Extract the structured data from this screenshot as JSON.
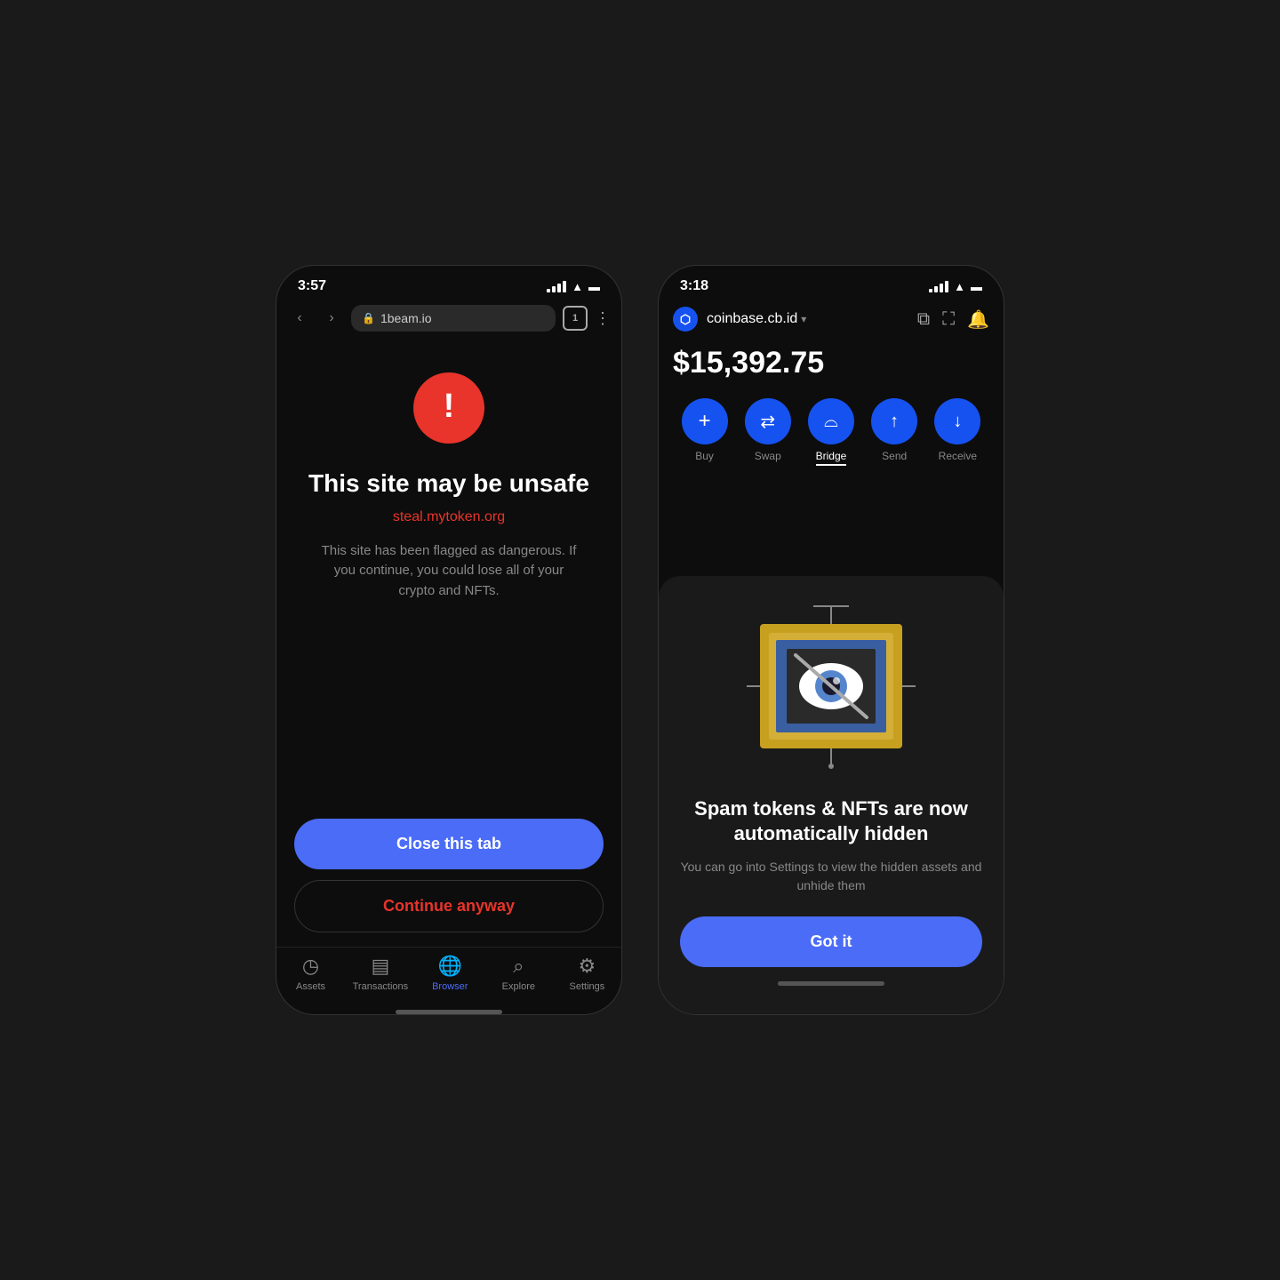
{
  "phone1": {
    "status": {
      "time": "3:57"
    },
    "browser": {
      "url": "1beam.io",
      "tab_count": "1"
    },
    "warning": {
      "title": "This site may be unsafe",
      "url": "steal.mytoken.org",
      "description": "This site has been flagged as dangerous. If you continue, you could lose all of your crypto and NFTs."
    },
    "buttons": {
      "close_tab": "Close this tab",
      "continue": "Continue anyway"
    },
    "nav": {
      "items": [
        {
          "label": "Assets",
          "icon": "🕐",
          "active": false
        },
        {
          "label": "Transactions",
          "icon": "📋",
          "active": false
        },
        {
          "label": "Browser",
          "icon": "🌐",
          "active": true
        },
        {
          "label": "Explore",
          "icon": "🔍",
          "active": false
        },
        {
          "label": "Settings",
          "icon": "⚙️",
          "active": false
        }
      ]
    }
  },
  "phone2": {
    "status": {
      "time": "3:18"
    },
    "header": {
      "site": "coinbase.cb.id",
      "chevron": "▾"
    },
    "balance": "$15,392.75",
    "actions": [
      {
        "label": "Buy",
        "icon": "+"
      },
      {
        "label": "Swap",
        "icon": "⇄"
      },
      {
        "label": "Bridge",
        "icon": "⌓",
        "active": true
      },
      {
        "label": "Send",
        "icon": "↑"
      },
      {
        "label": "Receive",
        "icon": "↓"
      }
    ],
    "modal": {
      "title": "Spam tokens & NFTs are now automatically hidden",
      "description": "You can go into Settings to view the hidden assets and unhide them",
      "button": "Got it"
    }
  }
}
